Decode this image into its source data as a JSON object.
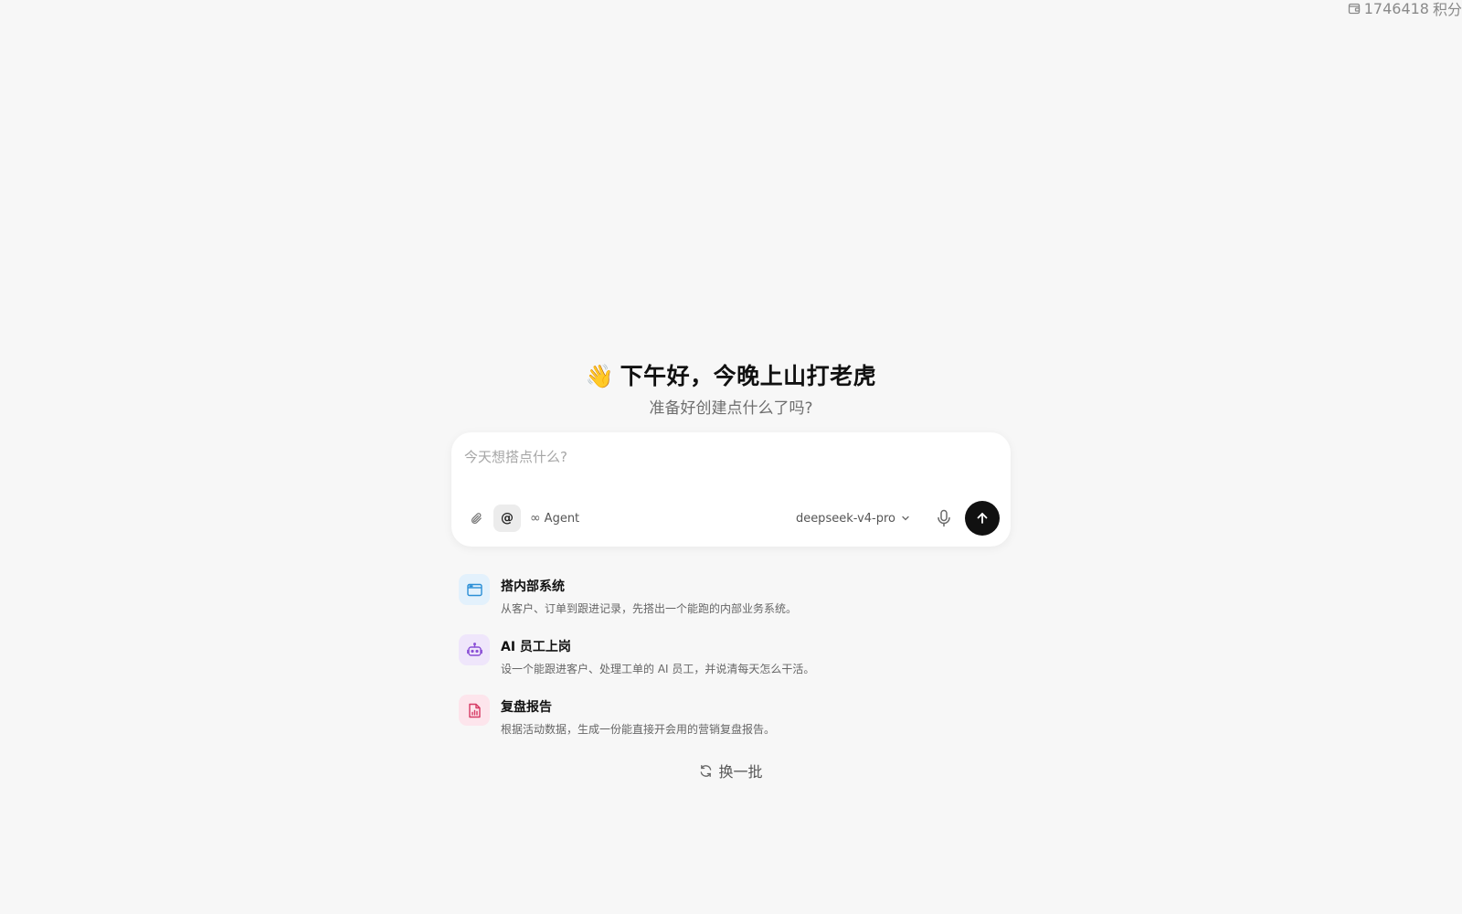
{
  "header": {
    "credits_value": "1746418",
    "credits_unit": "积分"
  },
  "hero": {
    "wave_emoji": "👋",
    "greeting": "下午好，今晚上山打老虎",
    "subtitle": "准备好创建点什么了吗?"
  },
  "composer": {
    "placeholder": "今天想搭点什么?",
    "value": "",
    "agent_symbol": "∞",
    "agent_label": "Agent",
    "model": "deepseek-v4-pro",
    "mention_symbol": "@"
  },
  "suggestions": [
    {
      "title": "搭内部系统",
      "desc": "从客户、订单到跟进记录，先搭出一个能跑的内部业务系统。",
      "icon": "browser-window-icon",
      "color": "#2b8fd6",
      "bg": "#e3f1fc"
    },
    {
      "title": "AI 员工上岗",
      "desc": "设一个能跟进客户、处理工单的 AI 员工，并说清每天怎么干活。",
      "icon": "robot-icon",
      "color": "#8a4fd6",
      "bg": "#efe6fb"
    },
    {
      "title": "复盘报告",
      "desc": "根据活动数据，生成一份能直接开会用的营销复盘报告。",
      "icon": "report-file-icon",
      "color": "#d63a64",
      "bg": "#fde5ec"
    }
  ],
  "refresh_label": "换一批",
  "colors": {
    "background": "#f7f7f7",
    "send_button": "#111111"
  }
}
